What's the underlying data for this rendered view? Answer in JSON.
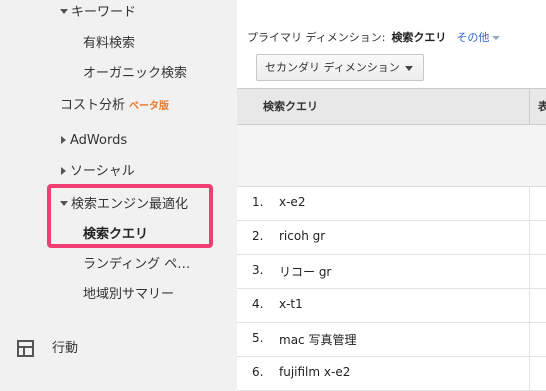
{
  "sidebar": {
    "keyword_section": "キーワード",
    "paid_search": "有料検索",
    "organic_search": "オーガニック検索",
    "cost_analysis": "コスト分析",
    "beta_badge": "ベータ版",
    "adwords": "AdWords",
    "social": "ソーシャル",
    "seo_section": "検索エンジン最適化",
    "search_queries": "検索クエリ",
    "landing_pages": "ランディング ペ…",
    "geo_summary": "地域別サマリー",
    "behavior": "行動"
  },
  "main": {
    "primary_dimension_label": "プライマリ ディメンション:",
    "primary_dimension_value": "検索クエリ",
    "other_link": "その他",
    "secondary_dimension_button": "セカンダリ ディメンション",
    "table": {
      "column_query": "検索クエリ",
      "column_next": "表",
      "rows": [
        {
          "index": "1.",
          "query": "x-e2"
        },
        {
          "index": "2.",
          "query": "ricoh gr"
        },
        {
          "index": "3.",
          "query": "リコー gr"
        },
        {
          "index": "4.",
          "query": "x-t1"
        },
        {
          "index": "5.",
          "query": "mac 写真管理"
        },
        {
          "index": "6.",
          "query": "fujifilm x-e2"
        }
      ]
    }
  },
  "colors": {
    "highlight_border": "#f23f72",
    "beta_orange": "#e6782a",
    "link_blue": "#3366cc"
  }
}
